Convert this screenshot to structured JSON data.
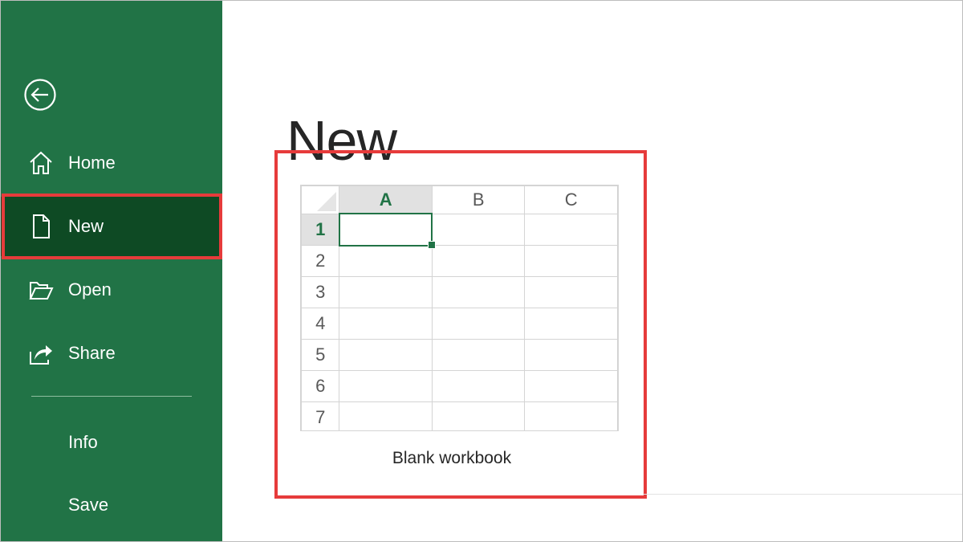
{
  "app": {
    "brand_color": "#217346",
    "selected_color": "#0e4a24",
    "highlight_color": "#e63b3b"
  },
  "sidebar": {
    "back_icon": "back-arrow-icon",
    "items": [
      {
        "label": "Home",
        "icon": "home-icon"
      },
      {
        "label": "New",
        "icon": "new-document-icon",
        "selected": true
      },
      {
        "label": "Open",
        "icon": "folder-open-icon"
      },
      {
        "label": "Share",
        "icon": "share-icon"
      },
      {
        "label": "Info"
      },
      {
        "label": "Save"
      }
    ]
  },
  "main": {
    "title": "New",
    "templates": [
      {
        "caption": "Blank workbook",
        "columns": [
          "A",
          "B",
          "C"
        ],
        "rows": [
          "1",
          "2",
          "3",
          "4",
          "5",
          "6",
          "7"
        ],
        "selected_cell": "A1"
      }
    ]
  }
}
